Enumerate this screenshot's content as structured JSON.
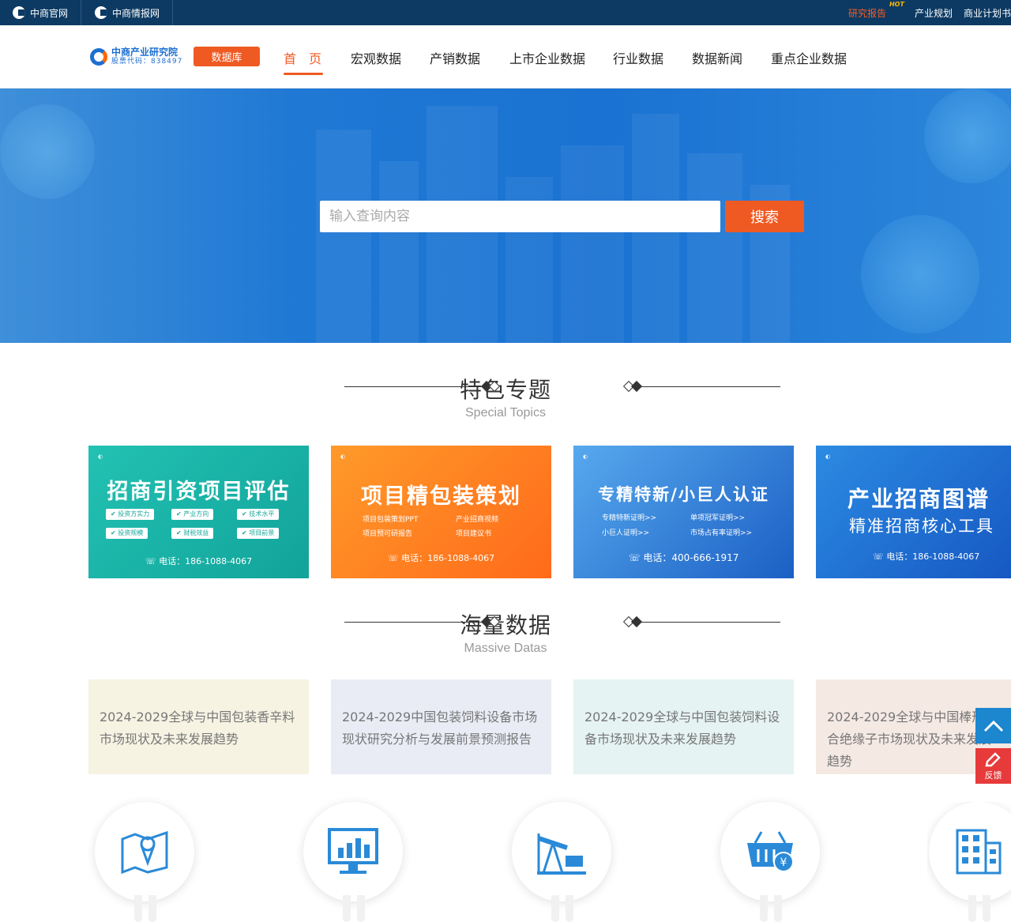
{
  "topbar": {
    "site1": "中商官网",
    "site2": "中商情报网",
    "links": [
      "研究报告",
      "产业规划",
      "商业计划书"
    ],
    "hot": "HOT"
  },
  "header": {
    "brand_cn": "中商产业研究院",
    "brand_code": "股票代码：838497",
    "db_button": "数据库",
    "nav": [
      "首　页",
      "宏观数据",
      "产销数据",
      "上市企业数据",
      "行业数据",
      "数据新闻",
      "重点企业数据"
    ]
  },
  "search": {
    "placeholder": "输入查询内容",
    "button": "搜索"
  },
  "sections": {
    "topics": {
      "cn": "特色专题",
      "en": "Special Topics"
    },
    "massive": {
      "cn": "海量数据",
      "en": "Massive Datas"
    }
  },
  "topics": [
    {
      "title": "招商引资项目评估",
      "tags": [
        "投资方实力",
        "产业方向",
        "技术水平",
        "投资规模",
        "财税效益",
        "项目前景"
      ],
      "phone": "电话：186-1088-4067",
      "color": "#19b0a6"
    },
    {
      "title": "项目精包装策划",
      "tags": [
        "项目包装策划PPT",
        "产业招商视频",
        "项目预可研报告",
        "项目建议书"
      ],
      "phone": "电话：186-1088-4067",
      "color": "#ff7a1f"
    },
    {
      "title": "专精特新/小巨人认证",
      "tags": [
        "专精特新证明>>",
        "单项冠军证明>>",
        "小巨人证明>>",
        "市场占有率证明>>"
      ],
      "phone": "电话：400-666-1917",
      "color": "#2a7ad8"
    },
    {
      "title": "产业招商图谱",
      "subtitle": "精准招商核心工具",
      "phone": "电话：186-1088-4067",
      "color": "#1c6fd6"
    }
  ],
  "data_cards": [
    {
      "text": "2024-2029全球与中国包装香辛料市场现状及未来发展趋势",
      "bg": "#f6f3e3"
    },
    {
      "text": "2024-2029中国包装饲料设备市场现状研究分析与发展前景预测报告",
      "bg": "#e9ecf5"
    },
    {
      "text": "2024-2029全球与中国包装饲料设备市场现状及未来发展趋势",
      "bg": "#e5f3f2"
    },
    {
      "text": "2024-2029全球与中国棒形组合绝缘子市场现状及未来发展趋势",
      "bg": "#f5e9e3"
    }
  ],
  "icons": [
    "map-icon",
    "monitor-chart-icon",
    "oil-pump-icon",
    "shopping-basket-icon",
    "building-icon"
  ],
  "float": {
    "feedback": "反馈"
  }
}
